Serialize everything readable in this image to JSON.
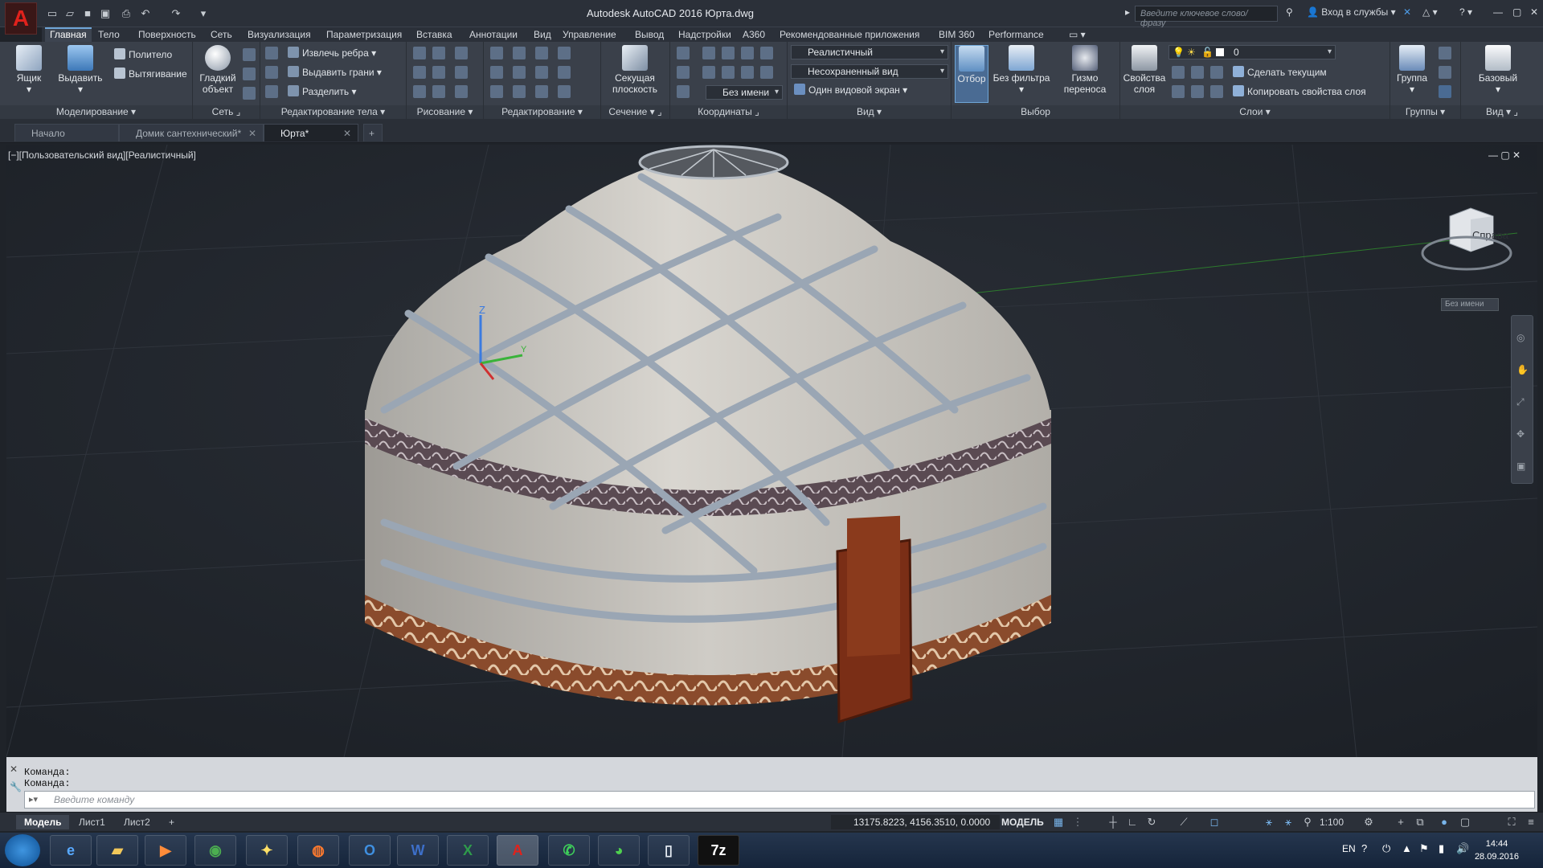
{
  "window": {
    "title": "Autodesk AutoCAD 2016   Юрта.dwg",
    "search_placeholder": "Введите ключевое слово/фразу",
    "signin": "Вход в службы"
  },
  "menu_tabs": [
    "Главная",
    "Тело",
    "Поверхность",
    "Сеть",
    "Визуализация",
    "Параметризация",
    "Вставка",
    "Аннотации",
    "Вид",
    "Управление",
    "Вывод",
    "Надстройки",
    "A360",
    "Рекомендованные приложения",
    "BIM 360",
    "Performance"
  ],
  "ribbon": {
    "modeling": {
      "title": "Моделирование",
      "box": "Ящик",
      "extrude": "Выдавить",
      "polysolid": "Политело",
      "sweep": "Вытягивание"
    },
    "mesh": {
      "title": "Сеть",
      "smooth": "Гладкий объект"
    },
    "solid_edit": {
      "title": "Редактирование тела",
      "extract_edges": "Извлечь ребра",
      "extrude_faces": "Выдавить грани",
      "separate": "Разделить"
    },
    "draw": {
      "title": "Рисование"
    },
    "modify": {
      "title": "Редактирование"
    },
    "section": {
      "title": "Сечение",
      "section_plane": "Секущая плоскость"
    },
    "coordinates": {
      "title": "Координаты",
      "ucs_name": "Без имени"
    },
    "view": {
      "title": "Вид",
      "visual_style": "Реалистичный",
      "named_view": "Несохраненный вид",
      "viewport": "Один видовой экран"
    },
    "selection": {
      "title": "Выбор",
      "culling": "Отбор",
      "no_filter": "Без фильтра",
      "gizmo": "Гизмо переноса"
    },
    "layers": {
      "title": "Слои",
      "layer_props": "Свойства слоя",
      "layer_name": "0",
      "make_current": "Сделать текущим",
      "match_layer": "Копировать свойства слоя"
    },
    "groups": {
      "title": "Группы",
      "group": "Группа"
    },
    "view2": {
      "title": "Вид",
      "base": "Базовый"
    }
  },
  "doc_tabs": [
    "Начало",
    "Домик сантехнический*",
    "Юрта*"
  ],
  "viewport": {
    "label": "[−][Пользовательский вид][Реалистичный]",
    "viewcube_face": "Справа",
    "ucs_label": "Без имени"
  },
  "command": {
    "history": [
      "Команда:",
      "Команда:"
    ],
    "placeholder": "Введите команду"
  },
  "status": {
    "layout_tabs": [
      "Модель",
      "Лист1",
      "Лист2"
    ],
    "coords": "13175.8223, 4156.3510, 0.0000",
    "model": "МОДЕЛЬ",
    "scale": "1:100"
  },
  "taskbar": {
    "lang": "EN",
    "time": "14:44",
    "date": "28.09.2016",
    "apps": [
      "ie-icon",
      "explorer-icon",
      "media-icon",
      "chrome-icon",
      "finch-icon",
      "firefox-icon",
      "outlook-icon",
      "word-icon",
      "excel-icon",
      "autocad-icon",
      "whatsapp-icon",
      "wechat-icon",
      "notepad-icon",
      "7zip-icon"
    ]
  },
  "colors": {
    "accent": "#6fa6d8",
    "felt": "#c9c6c0",
    "door": "#7a2e16",
    "ribbon_bg": "#3a404a"
  }
}
